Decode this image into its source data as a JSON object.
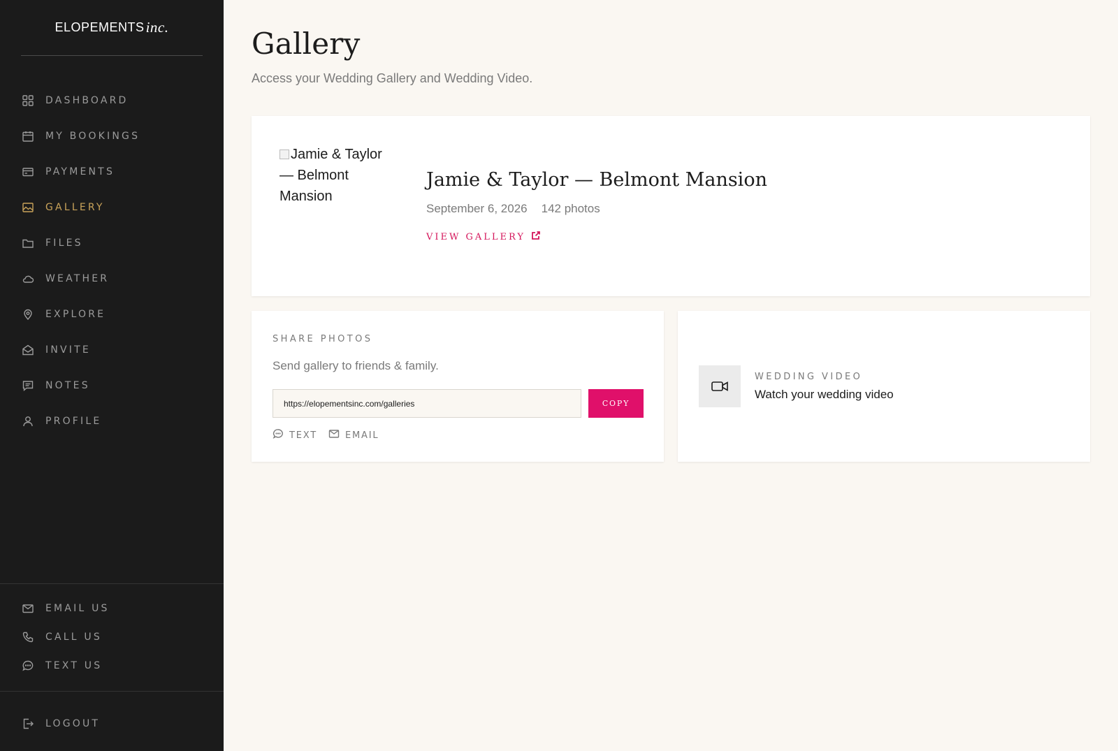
{
  "brand": {
    "main": "ELOPEMENTS",
    "accent": "inc."
  },
  "nav": [
    {
      "id": "dashboard",
      "label": "DASHBOARD",
      "icon": "grid-icon"
    },
    {
      "id": "bookings",
      "label": "MY BOOKINGS",
      "icon": "calendar-icon"
    },
    {
      "id": "payments",
      "label": "PAYMENTS",
      "icon": "credit-card-icon"
    },
    {
      "id": "gallery",
      "label": "GALLERY",
      "icon": "image-icon",
      "active": true
    },
    {
      "id": "files",
      "label": "FILES",
      "icon": "folder-icon"
    },
    {
      "id": "weather",
      "label": "WEATHER",
      "icon": "cloud-icon"
    },
    {
      "id": "explore",
      "label": "EXPLORE",
      "icon": "map-pin-icon"
    },
    {
      "id": "invite",
      "label": "INVITE",
      "icon": "envelope-open-icon"
    },
    {
      "id": "notes",
      "label": "NOTES",
      "icon": "message-square-icon"
    },
    {
      "id": "profile",
      "label": "PROFILE",
      "icon": "user-icon"
    }
  ],
  "support": [
    {
      "id": "email-us",
      "label": "EMAIL US",
      "icon": "mail-icon"
    },
    {
      "id": "call-us",
      "label": "CALL US",
      "icon": "phone-icon"
    },
    {
      "id": "text-us",
      "label": "TEXT US",
      "icon": "chat-bubble-icon"
    }
  ],
  "logout": {
    "label": "LOGOUT",
    "icon": "logout-icon"
  },
  "page": {
    "title": "Gallery",
    "subtitle": "Access your Wedding Gallery and Wedding Video."
  },
  "gallery": {
    "thumb_alt": "Jamie & Taylor — Belmont Mansion",
    "title": "Jamie & Taylor — Belmont Mansion",
    "date": "September 6, 2026",
    "photos": "142 photos",
    "view_label": "VIEW GALLERY"
  },
  "share": {
    "eyebrow": "SHARE PHOTOS",
    "description": "Send gallery to friends & family.",
    "url": "https://elopementsinc.com/galleries",
    "copy_label": "COPY",
    "text_label": "TEXT",
    "email_label": "EMAIL"
  },
  "video": {
    "eyebrow": "WEDDING VIDEO",
    "description": "Watch your wedding video"
  },
  "colors": {
    "sidebar_bg": "#1b1b1b",
    "page_bg": "#faf7f2",
    "active_nav": "#c9a35a",
    "accent": "#e0106a"
  }
}
